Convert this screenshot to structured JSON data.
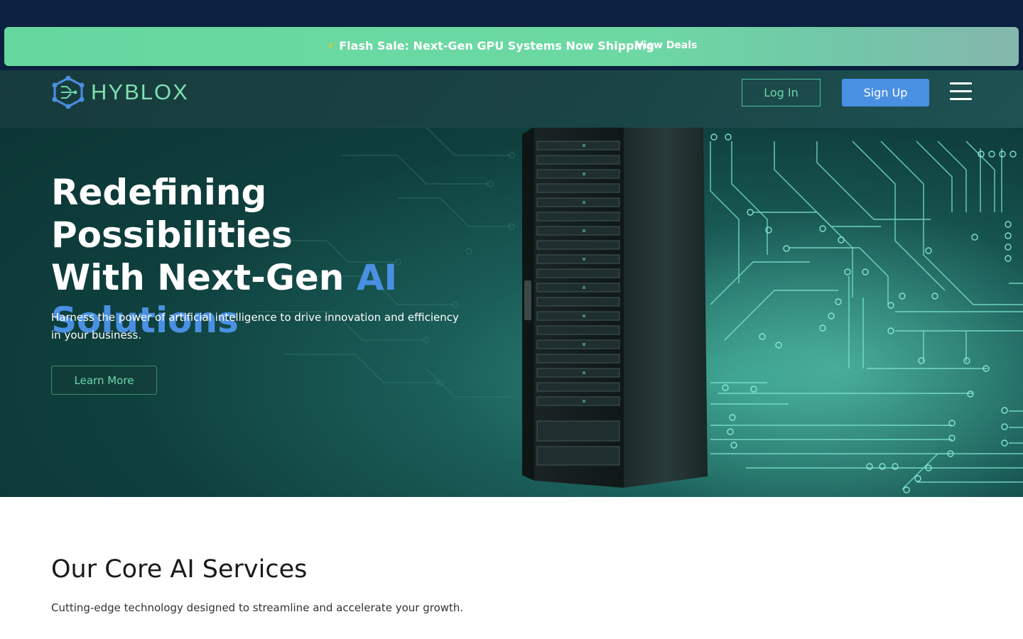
{
  "promo": {
    "bolt": "⚡",
    "text": "Flash Sale: Next-Gen GPU Systems Now Shipping",
    "link": "View Deals"
  },
  "nav": {
    "logo_text": "HYBLOX",
    "login_label": "Log In",
    "signup_label": "Sign Up",
    "menu_icon": "hamburger-menu-icon"
  },
  "hero": {
    "headline_line1": "Redefining Possibilities",
    "headline_line2": "With Next-Gen",
    "headline_accent_1": "AI",
    "headline_accent_2": "Solutions",
    "subtext": "Harness the power of artificial intelligence to drive innovation and efficiency in your business.",
    "cta_label": "Learn More"
  },
  "services": {
    "title": "Our Core AI Services",
    "subtitle": "Cutting-edge technology designed to streamline and accelerate your growth."
  },
  "colors": {
    "promo_bg": "#6cd9a3",
    "top_band": "#0a2140",
    "accent_blue": "#4a90e2",
    "accent_green": "#6fd6ab"
  }
}
